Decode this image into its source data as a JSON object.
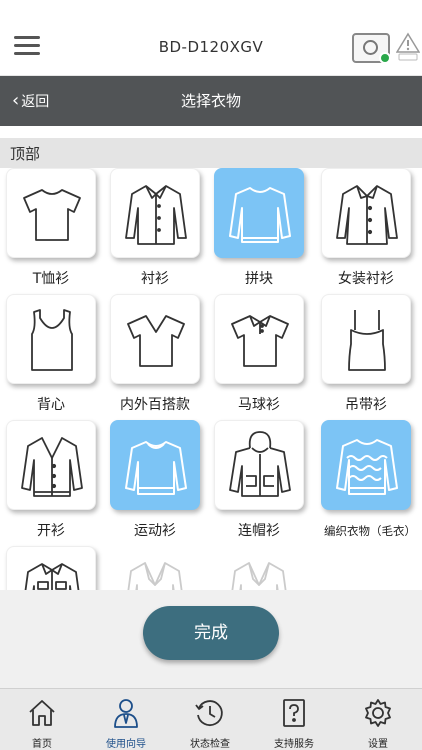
{
  "header": {
    "device_model": "BD-D120XGV"
  },
  "navbar": {
    "back_label": "返回",
    "title": "选择衣物"
  },
  "section": {
    "label": "顶部"
  },
  "garments": [
    {
      "label": "T恤衫",
      "icon": "tshirt-icon",
      "selected": false
    },
    {
      "label": "衬衫",
      "icon": "shirt-icon",
      "selected": false
    },
    {
      "label": "拼块",
      "icon": "sweater-icon",
      "selected": true
    },
    {
      "label": "女装衬衫",
      "icon": "blouse-icon",
      "selected": false
    },
    {
      "label": "背心",
      "icon": "tank-top-icon",
      "selected": false
    },
    {
      "label": "内外百搭款",
      "icon": "v-neck-tee-icon",
      "selected": false
    },
    {
      "label": "马球衫",
      "icon": "polo-shirt-icon",
      "selected": false
    },
    {
      "label": "吊带衫",
      "icon": "camisole-icon",
      "selected": false
    },
    {
      "label": "开衫",
      "icon": "cardigan-icon",
      "selected": false
    },
    {
      "label": "运动衫",
      "icon": "sweatshirt-icon",
      "selected": true
    },
    {
      "label": "连帽衫",
      "icon": "hoodie-icon",
      "selected": false
    },
    {
      "label": "编织衣物（毛衣）",
      "icon": "knit-sweater-icon",
      "selected": true
    }
  ],
  "footer": {
    "done_label": "完成"
  },
  "tabbar": {
    "items": [
      {
        "label": "首页",
        "icon": "home-icon"
      },
      {
        "label": "使用向导",
        "icon": "guide-person-icon"
      },
      {
        "label": "状态检查",
        "icon": "status-check-icon"
      },
      {
        "label": "支持服务",
        "icon": "support-icon"
      },
      {
        "label": "设置",
        "icon": "gear-icon"
      }
    ],
    "active_index": 1
  },
  "colors": {
    "navbar_bg": "#515456",
    "selected_card": "#7cc4f5",
    "done_button": "#3d6e7f",
    "active_tab": "#1d4f8a"
  }
}
